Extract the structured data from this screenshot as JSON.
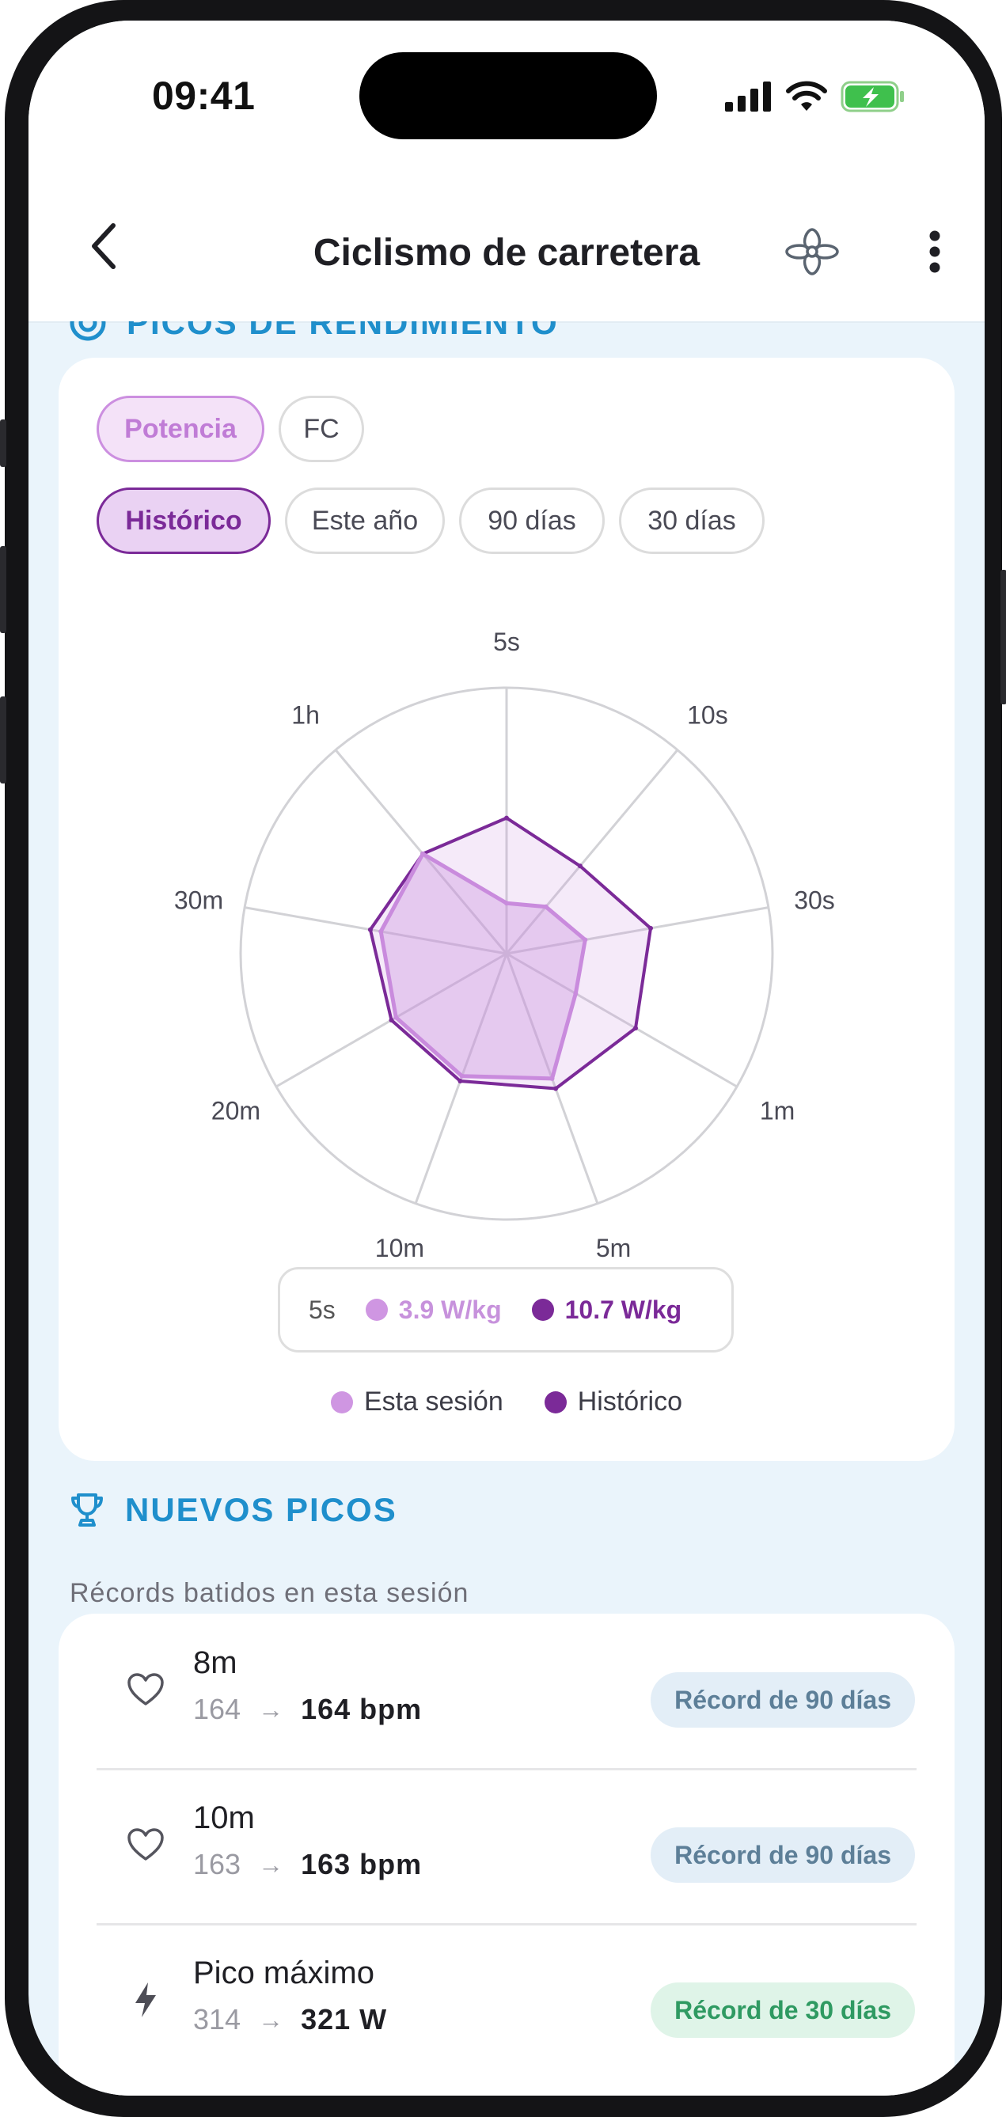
{
  "status_bar": {
    "time": "09:41"
  },
  "header": {
    "title": "Ciclismo de carretera"
  },
  "peaks_section": {
    "title": "PICOS DE RENDIMIENTO",
    "metric_tabs": [
      {
        "label": "Potencia",
        "active": true
      },
      {
        "label": "FC",
        "active": false
      }
    ],
    "range_tabs": [
      {
        "label": "Histórico",
        "active": true
      },
      {
        "label": "Este año",
        "active": false
      },
      {
        "label": "90 días",
        "active": false
      },
      {
        "label": "30 días",
        "active": false
      }
    ],
    "tooltip": {
      "label": "5s",
      "session_value": "3.9 W/kg",
      "historic_value": "10.7 W/kg"
    },
    "legend": {
      "session": "Esta sesión",
      "historic": "Histórico"
    }
  },
  "chart_data": {
    "type": "radar",
    "axes": [
      "5s",
      "10s",
      "30s",
      "1m",
      "5m",
      "10m",
      "20m",
      "30m",
      "1h"
    ],
    "rmax": 1.0,
    "grid": true,
    "series": [
      {
        "name": "Esta sesión",
        "color": "#c98bdd",
        "values": [
          0.19,
          0.23,
          0.3,
          0.3,
          0.5,
          0.49,
          0.48,
          0.48,
          0.49
        ]
      },
      {
        "name": "Histórico",
        "color": "#7b2a98",
        "values": [
          0.51,
          0.43,
          0.55,
          0.56,
          0.54,
          0.51,
          0.5,
          0.52,
          0.49
        ]
      }
    ]
  },
  "records_section": {
    "title": "NUEVOS PICOS",
    "subtitle": "Récords batidos en esta sesión",
    "items": [
      {
        "icon": "heart-icon",
        "name": "8m",
        "old": "164",
        "arrow": "→",
        "new": "164 bpm",
        "badge": "Récord de 90 días",
        "badge_color": "#e3eef7"
      },
      {
        "icon": "heart-icon",
        "name": "10m",
        "old": "163",
        "arrow": "→",
        "new": "163 bpm",
        "badge": "Récord de 90 días",
        "badge_color": "#e3eef7"
      },
      {
        "icon": "lightning-icon",
        "name": "Pico máximo",
        "old": "314",
        "arrow": "→",
        "new": "321 W",
        "badge": "Récord de 30 días",
        "badge_color": "#dff4e8"
      }
    ]
  }
}
